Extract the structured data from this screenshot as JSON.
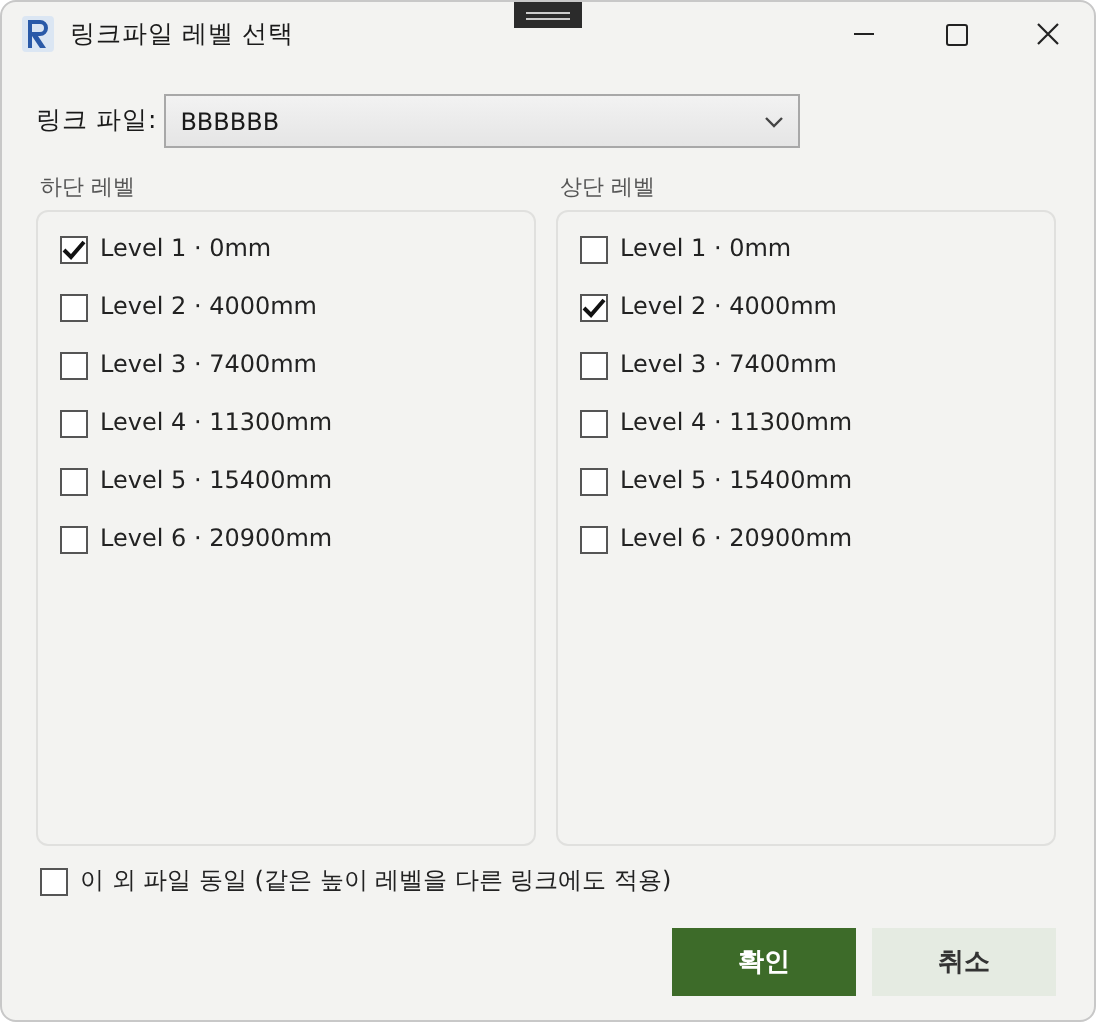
{
  "window": {
    "title": "링크파일 레벨 선택"
  },
  "link_file": {
    "label": "링크 파일:",
    "value": "BBBBBB"
  },
  "panels": [
    {
      "title": "하단 레벨",
      "items": [
        {
          "label": "Level 1 · 0mm",
          "checked": true
        },
        {
          "label": "Level 2 · 4000mm",
          "checked": false
        },
        {
          "label": "Level 3 · 7400mm",
          "checked": false
        },
        {
          "label": "Level 4 · 11300mm",
          "checked": false
        },
        {
          "label": "Level 5 · 15400mm",
          "checked": false
        },
        {
          "label": "Level 6 · 20900mm",
          "checked": false
        }
      ]
    },
    {
      "title": "상단 레벨",
      "items": [
        {
          "label": "Level 1 · 0mm",
          "checked": false
        },
        {
          "label": "Level 2 · 4000mm",
          "checked": true
        },
        {
          "label": "Level 3 · 7400mm",
          "checked": false
        },
        {
          "label": "Level 4 · 11300mm",
          "checked": false
        },
        {
          "label": "Level 5 · 15400mm",
          "checked": false
        },
        {
          "label": "Level 6 · 20900mm",
          "checked": false
        }
      ]
    }
  ],
  "apply_all": {
    "label": "이 외 파일 동일 (같은 높이 레벨을 다른 링크에도 적용)",
    "checked": false
  },
  "buttons": [
    {
      "label": "확인",
      "kind": "primary"
    },
    {
      "label": "취소",
      "kind": "secondary"
    }
  ]
}
